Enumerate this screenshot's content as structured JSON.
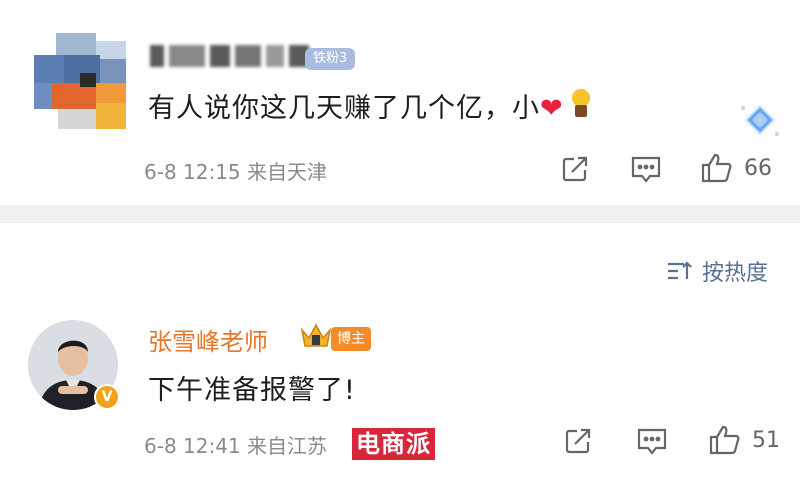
{
  "comment1": {
    "badge": "铁粉3",
    "text": "有人说你这几天赚了几个亿，小",
    "meta": "6-8 12:15 来自天津",
    "likes": "66"
  },
  "sort": {
    "label": "按热度"
  },
  "comment2": {
    "username": "张雪峰老师",
    "badge": "博主",
    "verified_glyph": "V",
    "text": "下午准备报警了!",
    "meta": "6-8 12:41 来自江苏",
    "likes": "51"
  },
  "watermark": {
    "text": "电商派"
  },
  "colors": {
    "username_orange": "#e6762a",
    "host_badge": "#f58c2a",
    "fan_badge": "#a9bce0",
    "sort_blue": "#5a6f96",
    "heart_red": "#e8223c",
    "meta_gray": "#8a8a8a"
  },
  "icons": {
    "share": "share-icon",
    "comment": "comment-icon",
    "like": "thumbs-up-icon",
    "sort": "sort-icon",
    "heart": "heart-emoji-icon",
    "bulb": "lightbulb-emoji-icon",
    "crown": "crown-icon",
    "verified": "verified-v-icon",
    "sticker": "diamond-sticker-icon"
  }
}
